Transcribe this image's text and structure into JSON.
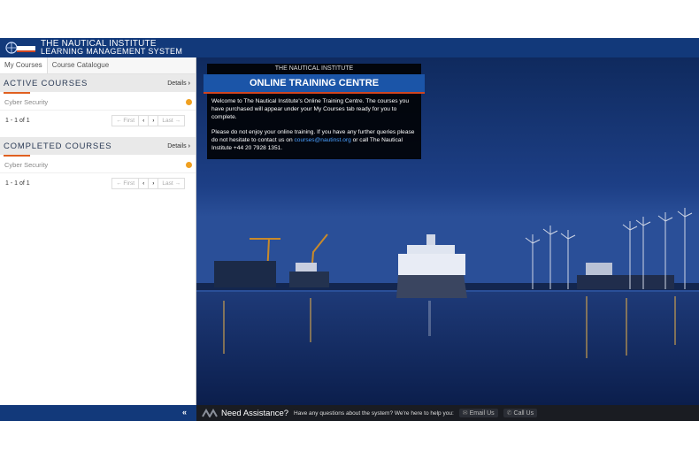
{
  "header": {
    "brand_line1": "THE NAUTICAL INSTITUTE",
    "brand_line2": "LEARNING MANAGEMENT SYSTEM",
    "logo_alt": "The Nautical Institute"
  },
  "sidebar": {
    "tabs": [
      {
        "label": "My Courses"
      },
      {
        "label": "Course Catalogue"
      }
    ],
    "active_courses": {
      "title": "ACTIVE COURSES",
      "details": "Details",
      "course": "Cyber Security",
      "count": "1 - 1 of 1",
      "first": "← First",
      "prev": "‹",
      "next": "›",
      "last": "Last →"
    },
    "completed_courses": {
      "title": "COMPLETED COURSES",
      "details": "Details",
      "course": "Cyber Security",
      "count": "1 - 1 of 1",
      "first": "← First",
      "prev": "‹",
      "next": "›",
      "last": "Last →"
    },
    "collapse_label": "«"
  },
  "info": {
    "top": "THE NAUTICAL INSTITUTE",
    "banner": "ONLINE TRAINING CENTRE",
    "p1": "Welcome to The Nautical Institute's Online Training Centre. The courses you have purchased will appear under your My Courses tab ready for you to complete.",
    "p2_before": "Please do not enjoy your online training. If you have any further queries please do not hesitate to contact us on",
    "email": "courses@nautinst.org",
    "p2_after": "or call The Nautical Institute +44 20 7928 1351."
  },
  "assist": {
    "title": "Need Assistance?",
    "text": "Have any questions about the system? We're here to help you:",
    "email": "Email Us",
    "call": "Call Us"
  },
  "colors": {
    "brand_blue": "#12397a",
    "accent_orange": "#e06020",
    "banner_blue": "#1b55a8"
  }
}
